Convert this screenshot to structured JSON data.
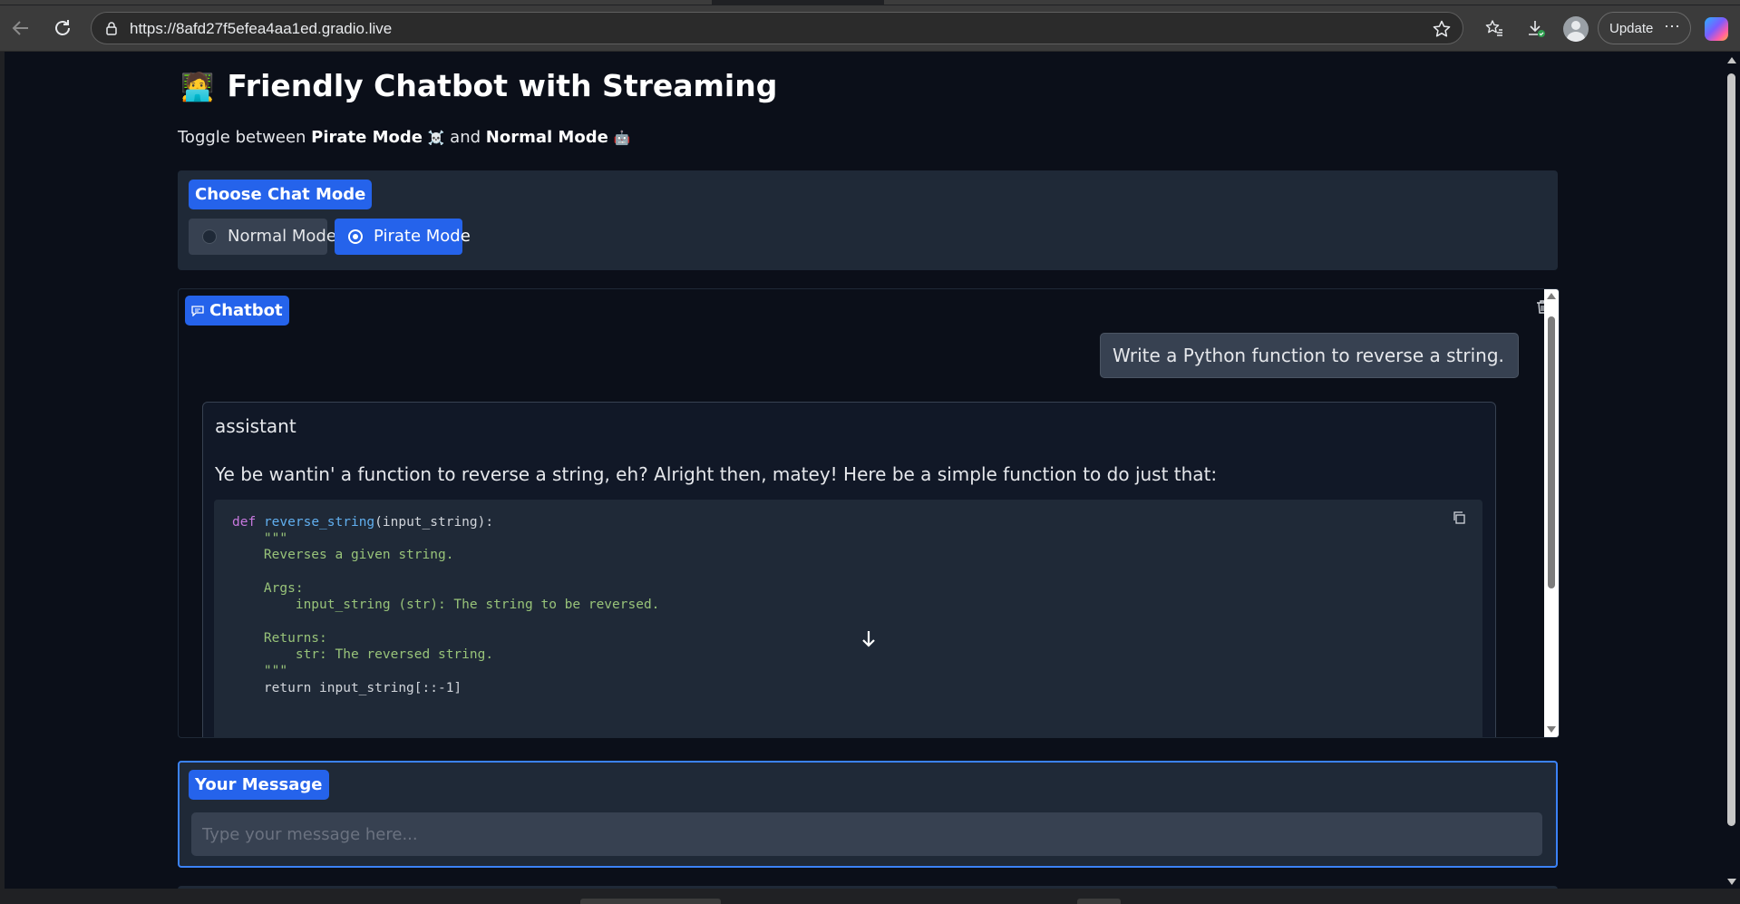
{
  "browser": {
    "url": "https://8afd27f5efea4aa1ed.gradio.live",
    "update_label": "Update",
    "more_label": "⋯"
  },
  "app": {
    "title": "Friendly Chatbot with Streaming",
    "title_emoji": "🧑‍💻",
    "subtitle": {
      "prefix": "Toggle between",
      "pirate": "Pirate Mode",
      "pirate_emoji": "☠️",
      "and": "and",
      "normal": "Normal Mode",
      "normal_emoji": "🤖"
    }
  },
  "mode": {
    "label": "Choose Chat Mode",
    "options": [
      {
        "label": "Normal Mode",
        "selected": false
      },
      {
        "label": "Pirate Mode",
        "selected": true
      }
    ]
  },
  "chatbot": {
    "label": "Chatbot",
    "user_message": "Write a Python function to reverse a string.",
    "assistant_role": "assistant",
    "assistant_text": "Ye be wantin' a function to reverse a string, eh? Alright then, matey! Here be a simple function to do just that:",
    "code": {
      "def_kw": "def",
      "func_name": "reverse_string",
      "signature_rest": "(input_string):",
      "lines": [
        "    \"\"\"",
        "    Reverses a given string.",
        "",
        "    Args:",
        "        input_string (str): The string to be reversed.",
        "",
        "    Returns:",
        "        str: The reversed string.",
        "    \"\"\"",
        "    return input_string[::-1]"
      ]
    }
  },
  "message": {
    "label": "Your Message",
    "placeholder": "Type your message here..."
  },
  "colors": {
    "accent": "#2563eb",
    "page_bg": "#0b0f19",
    "panel_bg": "#1f2937"
  }
}
